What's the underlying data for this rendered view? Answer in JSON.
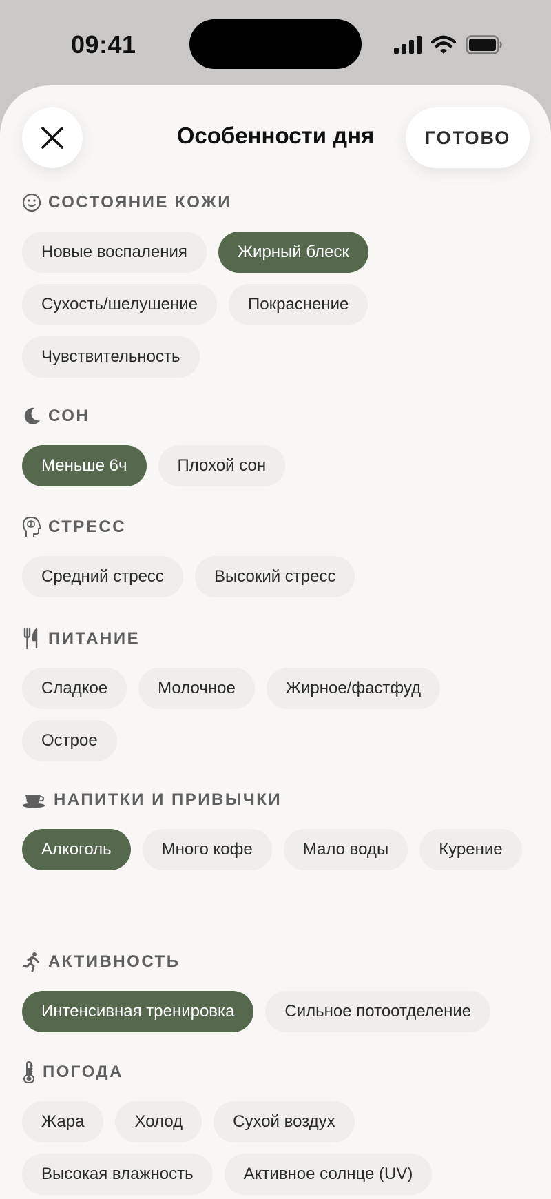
{
  "status": {
    "time": "09:41"
  },
  "header": {
    "title": "Особенности дня",
    "done_label": "ГОТОВО"
  },
  "colors": {
    "accent": "#56694c",
    "chip_bg": "#efeeeb",
    "sheet_bg": "#f8f7f5"
  },
  "sections": [
    {
      "title": "СОСТОЯНИЕ КОЖИ",
      "icon": "smiley-icon",
      "chips": [
        {
          "label": "Новые воспаления",
          "selected": false
        },
        {
          "label": "Жирный блеск",
          "selected": true
        },
        {
          "label": "Сухость/шелушение",
          "selected": false
        },
        {
          "label": "Покраснение",
          "selected": false
        },
        {
          "label": "Чувствительность",
          "selected": false
        }
      ]
    },
    {
      "title": "СОН",
      "icon": "moon-icon",
      "chips": [
        {
          "label": "Меньше 6ч",
          "selected": true
        },
        {
          "label": "Плохой сон",
          "selected": false
        }
      ]
    },
    {
      "title": "СТРЕСС",
      "icon": "brain-head-icon",
      "chips": [
        {
          "label": "Средний стресс",
          "selected": false
        },
        {
          "label": "Высокий стресс",
          "selected": false
        }
      ]
    },
    {
      "title": "ПИТАНИЕ",
      "icon": "fork-knife-icon",
      "chips": [
        {
          "label": "Сладкое",
          "selected": false
        },
        {
          "label": "Молочное",
          "selected": false
        },
        {
          "label": "Жирное/фастфуд",
          "selected": false
        },
        {
          "label": "Острое",
          "selected": false
        }
      ]
    },
    {
      "title": "НАПИТКИ И ПРИВЫЧКИ",
      "icon": "cup-icon",
      "chips": [
        {
          "label": "Алкоголь",
          "selected": true
        },
        {
          "label": "Много кофе",
          "selected": false
        },
        {
          "label": "Мало воды",
          "selected": false
        },
        {
          "label": "Курение",
          "selected": false
        }
      ]
    },
    {
      "title": "АКТИВНОСТЬ",
      "icon": "running-icon",
      "chips": [
        {
          "label": "Интенсивная тренировка",
          "selected": true
        },
        {
          "label": "Сильное потоотделение",
          "selected": false
        }
      ]
    },
    {
      "title": "ПОГОДА",
      "icon": "thermometer-icon",
      "chips": [
        {
          "label": "Жара",
          "selected": false
        },
        {
          "label": "Холод",
          "selected": false
        },
        {
          "label": "Сухой воздух",
          "selected": false
        },
        {
          "label": "Высокая влажность",
          "selected": false
        },
        {
          "label": "Активное солнце (UV)",
          "selected": false
        }
      ]
    }
  ]
}
